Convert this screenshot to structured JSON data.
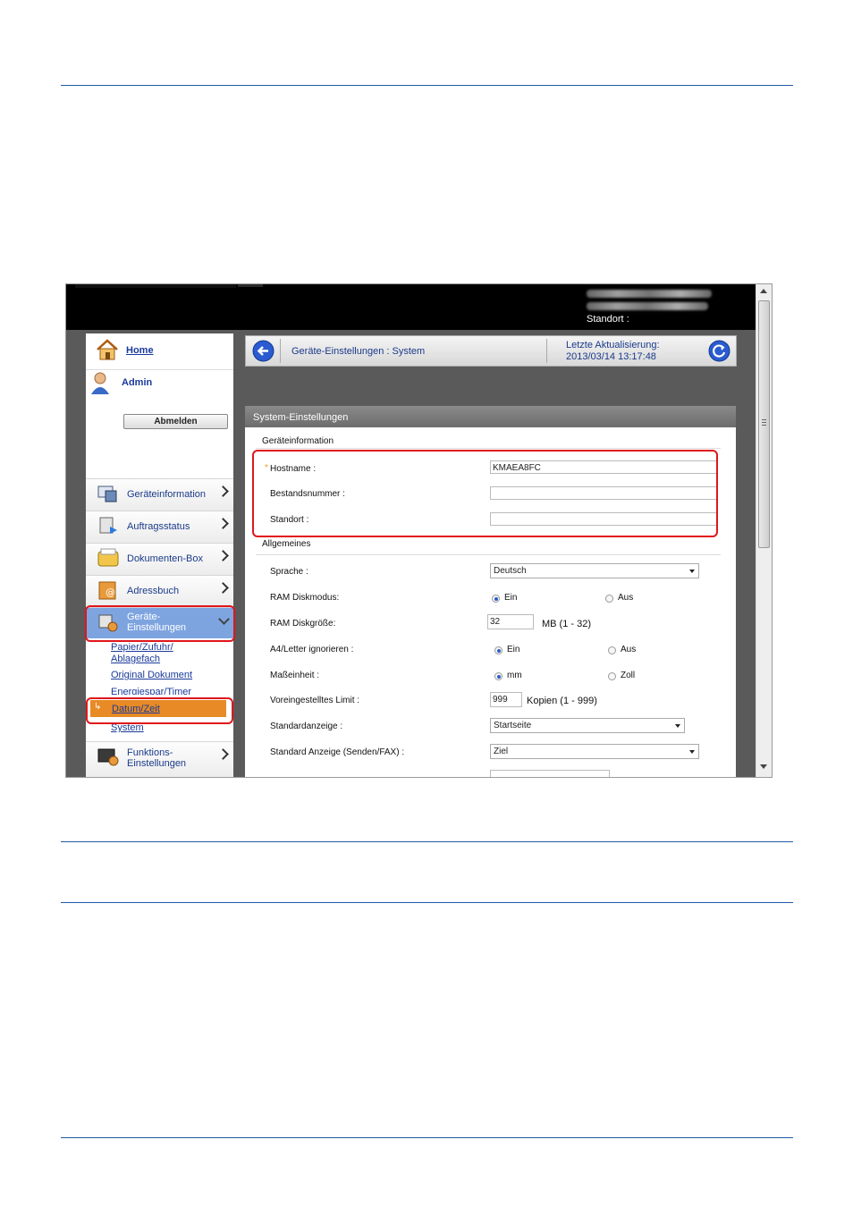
{
  "header": {
    "standort_label": "Standort :"
  },
  "sidebar": {
    "home": "Home",
    "user": "Admin",
    "logout": "Abmelden",
    "items": [
      {
        "label": "Geräteinformation",
        "icon": "device-info-icon"
      },
      {
        "label": "Auftragsstatus",
        "icon": "job-status-icon"
      },
      {
        "label": "Dokumenten-Box",
        "icon": "document-box-icon"
      },
      {
        "label": "Adressbuch",
        "icon": "address-book-icon"
      },
      {
        "label_line1": "Geräte-",
        "label_line2": "Einstellungen",
        "icon": "device-settings-icon"
      },
      {
        "label_line1": "Funktions-",
        "label_line2": "Einstellungen",
        "icon": "function-settings-icon"
      }
    ],
    "subitems": {
      "paper1": "Papier/Zufuhr/",
      "paper2": "Ablagefach",
      "original": "Original Dokument",
      "energy": "Energiespar/Timer",
      "datetime": "Datum/Zeit",
      "system": "System"
    }
  },
  "navbar": {
    "breadcrumb": "Geräte-Einstellungen : System",
    "last_update_label": "Letzte Aktualisierung:",
    "last_update_value": "2013/03/14 13:17:48"
  },
  "panel": {
    "title": "System-Einstellungen",
    "section_device": "Geräteinformation",
    "required_mark": "*",
    "hostname_label": "Hostname :",
    "hostname_value": "KMAEA8FC",
    "asset_label": "Bestandsnummer :",
    "asset_value": "",
    "location_label": "Standort :",
    "location_value": "",
    "section_general": "Allgemeines",
    "language_label": "Sprache :",
    "language_value": "Deutsch",
    "ramdisk_label": "RAM Diskmodus:",
    "on": "Ein",
    "off": "Aus",
    "ramsize_label": "RAM Diskgröße:",
    "ramsize_value": "32",
    "ramsize_unit": "MB (1 - 32)",
    "a4letter_label": "A4/Letter ignorieren :",
    "unit_label": "Maßeinheit :",
    "mm": "mm",
    "inch": "Zoll",
    "limit_label": "Voreingestelltes Limit :",
    "limit_value": "999",
    "limit_unit": "Kopien (1 - 999)",
    "default_screen_label": "Standardanzeige :",
    "default_screen_value": "Startseite",
    "default_send_label": "Standard Anzeige (Senden/FAX) :",
    "default_send_value": "Ziel"
  },
  "colors": {
    "highlight": "#e0161b",
    "active_item": "#e88a25",
    "selected_menu": "#7ea4e0",
    "rule": "#1f5aa6"
  }
}
